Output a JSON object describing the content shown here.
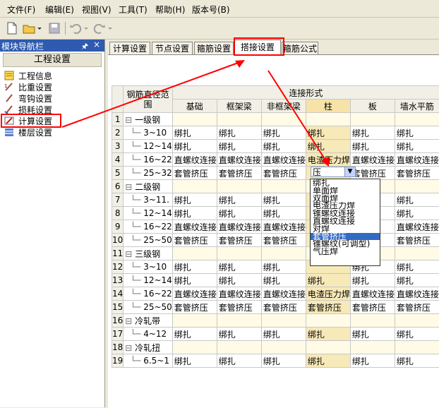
{
  "menu": [
    "文件(F)",
    "编辑(E)",
    "视图(V)",
    "工具(T)",
    "帮助(H)",
    "版本号(B)"
  ],
  "nav": {
    "header": "模块导航栏",
    "pin": "🖈",
    "close": "×",
    "title": "工程设置",
    "items": [
      "工程信息",
      "比重设置",
      "弯钩设置",
      "损耗设置",
      "计算设置",
      "楼层设置"
    ]
  },
  "tabs": [
    "计算设置",
    "节点设置",
    "箍筋设置",
    "搭接设置",
    "箍筋公式"
  ],
  "table": {
    "header_diam": "钢筋直径范围",
    "header_group": "连接形式",
    "columns": [
      "基础",
      "框架梁",
      "非框架梁",
      "柱",
      "板",
      "墙水平筋"
    ],
    "rows": [
      {
        "n": "1",
        "name": "一级钢",
        "cat": true,
        "cells": [
          "",
          "",
          "",
          "",
          "",
          ""
        ]
      },
      {
        "n": "2",
        "name": "3~10",
        "cells": [
          "绑扎",
          "绑扎",
          "绑扎",
          "绑扎",
          "绑扎",
          "绑扎"
        ]
      },
      {
        "n": "3",
        "name": "12~14",
        "cells": [
          "绑扎",
          "绑扎",
          "绑扎",
          "绑扎",
          "绑扎",
          "绑扎"
        ]
      },
      {
        "n": "4",
        "name": "16~22",
        "cells": [
          "直螺纹连接",
          "直螺纹连接",
          "直螺纹连接",
          "电渣压力焊",
          "直螺纹连接",
          "直螺纹连接"
        ]
      },
      {
        "n": "5",
        "name": "25~32",
        "cells": [
          "套管挤压",
          "套管挤压",
          "套管挤压",
          "",
          "套管挤压",
          "套管挤压"
        ]
      },
      {
        "n": "6",
        "name": "二级钢",
        "cat": true,
        "cells": [
          "",
          "",
          "",
          "",
          "",
          ""
        ]
      },
      {
        "n": "7",
        "name": "3~11.",
        "cells": [
          "绑扎",
          "绑扎",
          "绑扎",
          "",
          "",
          "绑扎"
        ]
      },
      {
        "n": "8",
        "name": "12~14",
        "cells": [
          "绑扎",
          "绑扎",
          "绑扎",
          "",
          "",
          "绑扎"
        ]
      },
      {
        "n": "9",
        "name": "16~22",
        "cells": [
          "直螺纹连接",
          "直螺纹连接",
          "直螺纹连接",
          "",
          "纹连接",
          "直螺纹连接"
        ]
      },
      {
        "n": "10",
        "name": "25~50",
        "cells": [
          "套管挤压",
          "套管挤压",
          "套管挤压",
          "",
          "",
          "套管挤压"
        ]
      },
      {
        "n": "11",
        "name": "三级钢",
        "cat": true,
        "cells": [
          "",
          "",
          "",
          "",
          "",
          ""
        ]
      },
      {
        "n": "12",
        "name": "3~10",
        "cells": [
          "绑扎",
          "绑扎",
          "绑扎",
          "",
          "绑扎",
          "绑扎"
        ]
      },
      {
        "n": "13",
        "name": "12~14",
        "cells": [
          "绑扎",
          "绑扎",
          "绑扎",
          "绑扎",
          "绑扎",
          "绑扎"
        ]
      },
      {
        "n": "14",
        "name": "16~22",
        "cells": [
          "直螺纹连接",
          "直螺纹连接",
          "直螺纹连接",
          "电渣压力焊",
          "直螺纹连接",
          "直螺纹连接"
        ]
      },
      {
        "n": "15",
        "name": "25~50",
        "cells": [
          "套管挤压",
          "套管挤压",
          "套管挤压",
          "套管挤压",
          "套管挤压",
          "套管挤压"
        ]
      },
      {
        "n": "16",
        "name": "冷轧带",
        "cat": true,
        "cells": [
          "",
          "",
          "",
          "",
          "",
          ""
        ]
      },
      {
        "n": "17",
        "name": "4~12",
        "cells": [
          "绑扎",
          "绑扎",
          "绑扎",
          "绑扎",
          "绑扎",
          "绑扎"
        ]
      },
      {
        "n": "18",
        "name": "冷轧扭",
        "cat": true,
        "cells": [
          "",
          "",
          "",
          "",
          "",
          ""
        ]
      },
      {
        "n": "19",
        "name": "6.5~1",
        "cells": [
          "绑扎",
          "绑扎",
          "绑扎",
          "绑扎",
          "绑扎",
          "绑扎"
        ]
      }
    ]
  },
  "combo": {
    "value": "压",
    "arrow": "▼"
  },
  "dropdown": [
    "绑扎",
    "单面焊",
    "双面焊",
    "电渣压力焊",
    "锥螺纹连接",
    "直螺纹连接",
    "对焊",
    "套管挤压",
    "锥螺纹(可调型)",
    "气压焊"
  ],
  "dropdown_selected": 7,
  "colors": {
    "accent": "#316ac5",
    "annotation": "#ff0000"
  }
}
